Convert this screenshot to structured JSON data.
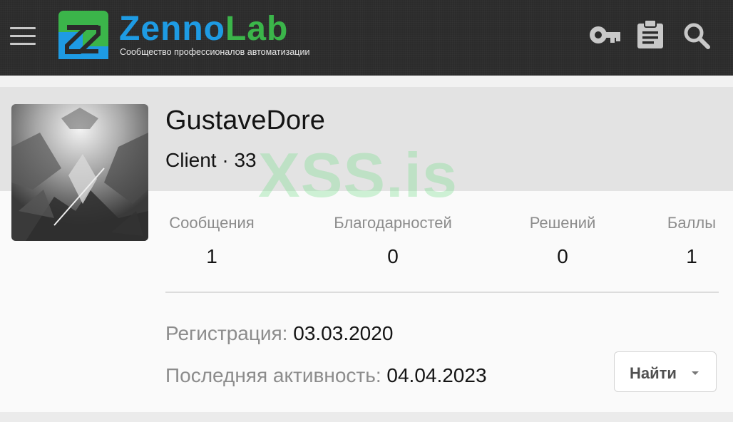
{
  "header": {
    "logo_word_1": "Zenno",
    "logo_word_2": "Lab",
    "tagline": "Сообщество профессионалов автоматизации",
    "icons": [
      "menu-icon",
      "key-icon",
      "clipboard-icon",
      "search-icon"
    ]
  },
  "profile": {
    "username": "GustaveDore",
    "title": "Client · 33",
    "watermark": "XSS.is",
    "stats": [
      {
        "label": "Сообщения",
        "value": "1"
      },
      {
        "label": "Благодарностей",
        "value": "0"
      },
      {
        "label": "Решений",
        "value": "0"
      },
      {
        "label": "Баллы",
        "value": "1"
      }
    ],
    "registration_label": "Регистрация:",
    "registration_value": "03.03.2020",
    "last_activity_label": "Последняя активность:",
    "last_activity_value": "04.04.2023",
    "find_button": "Найти"
  },
  "colors": {
    "header_bg": "#2b2b2b",
    "logo_blue": "#1e9be3",
    "logo_green": "#3bb54a",
    "band_bg": "#e3e3e3",
    "label_gray": "#8c8c8c"
  }
}
